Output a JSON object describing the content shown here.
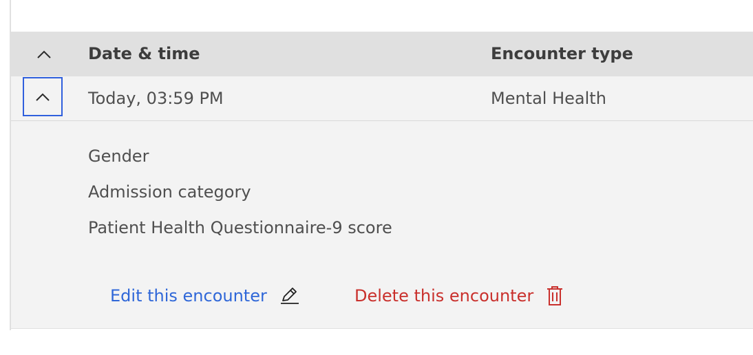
{
  "table": {
    "columns": {
      "date": "Date & time",
      "type": "Encounter type"
    },
    "row": {
      "date": "Today, 03:59 PM",
      "type": "Mental Health"
    },
    "details": [
      "Gender",
      "Admission category",
      "Patient Health Questionnaire-9 score"
    ],
    "actions": {
      "edit_label": "Edit this encounter",
      "edit_icon": "pencil-icon",
      "delete_label": "Delete this encounter",
      "delete_icon": "trash-icon"
    }
  },
  "colors": {
    "header_bg": "#e0e0e0",
    "row_bg": "#f3f3f3",
    "focus": "#2f5fdd",
    "link": "#2f67d8",
    "danger": "#c9302c"
  }
}
